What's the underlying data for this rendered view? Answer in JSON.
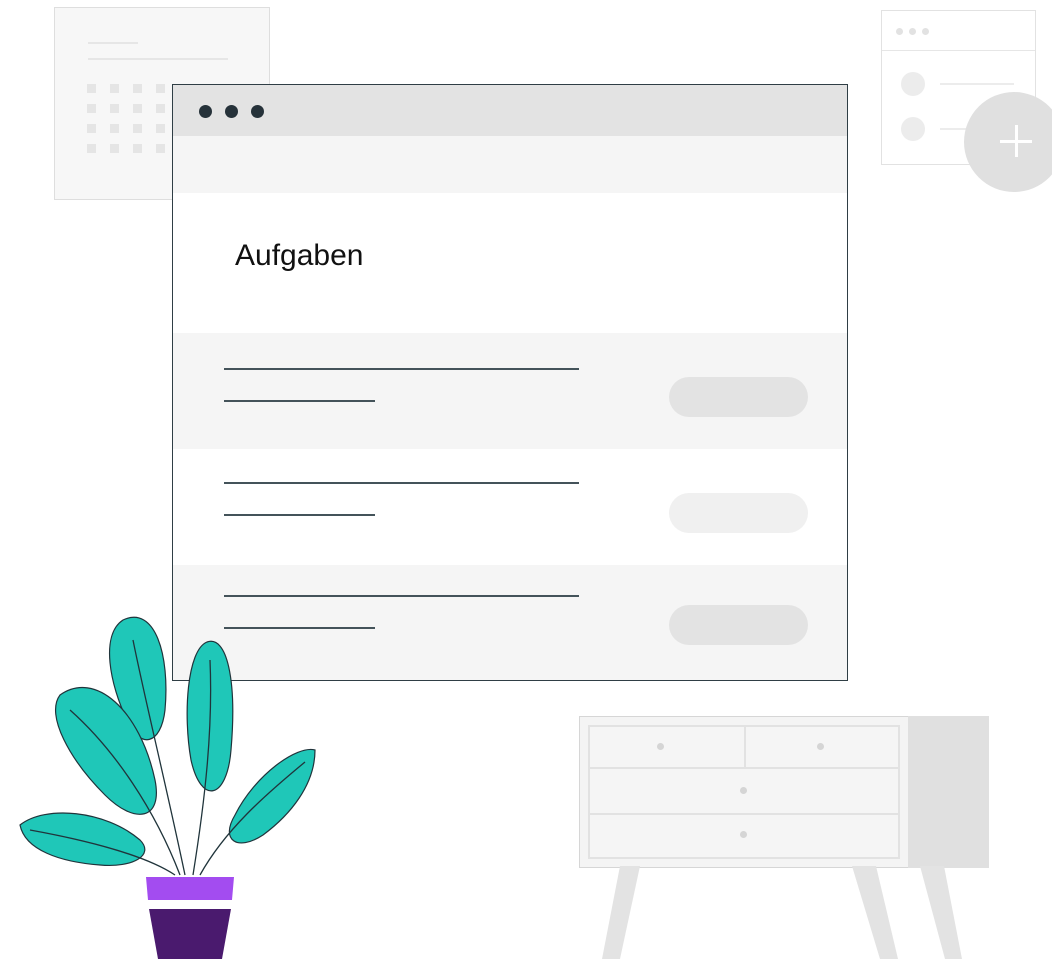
{
  "main_window": {
    "title": "Aufgaben",
    "task_rows": [
      {
        "background": "#f5f5f5",
        "pill_color": "#e3e3e3"
      },
      {
        "background": "#ffffff",
        "pill_color": "#f0f0f0"
      },
      {
        "background": "#f5f5f5",
        "pill_color": "#e3e3e3"
      }
    ],
    "window_dots_color": "#26323a"
  },
  "add_button": {
    "icon": "plus-icon",
    "color": "#e0e0e0"
  },
  "plant": {
    "leaf_color": "#1fc7b8",
    "pot_colors": [
      "#a34cf0",
      "#4a1a6e"
    ]
  },
  "colors": {
    "line": "#44535a",
    "window_border": "#2f3e45",
    "titlebar": "#e3e3e3"
  }
}
